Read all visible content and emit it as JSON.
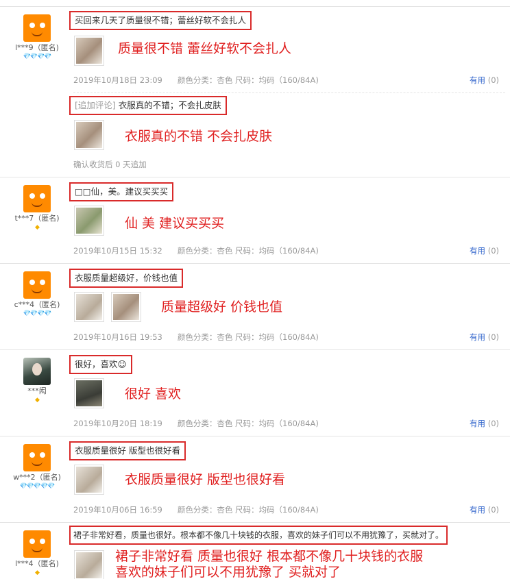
{
  "reviews": [
    {
      "user": "l***9（匿名)",
      "level": "💎💎💎💎",
      "text": "买回来几天了质量很不错；蕾丝好软不会扎人",
      "annotation": "质量很不错   蕾丝好软不会扎人",
      "date": "2019年10月18日 23:09",
      "color": "颜色分类：杏色",
      "size": "尺码：均码（160/84A)",
      "useful_label": "有用",
      "useful_count": "(0)",
      "followup": {
        "tag": "[追加评论]",
        "text": "衣服真的不错；不会扎皮肤",
        "annotation": "衣服真的不错   不会扎皮肤",
        "note": "确认收货后 0 天追加"
      }
    },
    {
      "user": "t***7（匿名)",
      "level": "◆",
      "text": "□□仙，美。建议买买买",
      "annotation": "仙    美    建议买买买",
      "date": "2019年10月15日 15:32",
      "color": "颜色分类：杏色",
      "size": "尺码：均码（160/84A)",
      "useful_label": "有用",
      "useful_count": "(0)"
    },
    {
      "user": "c***4（匿名)",
      "level": "💎💎💎💎",
      "text": "衣服质量超级好，价钱也值",
      "annotation": "质量超级好    价钱也值",
      "date": "2019年10月16日 19:53",
      "color": "颜色分类：杏色",
      "size": "尺码：均码（160/84A)",
      "useful_label": "有用",
      "useful_count": "(0)"
    },
    {
      "user": "***闳",
      "level": "◆",
      "text": "很好，喜欢☺",
      "annotation": "很好   喜欢",
      "date": "2019年10月20日 18:19",
      "color": "颜色分类：杏色",
      "size": "尺码：均码（160/84A)",
      "useful_label": "有用",
      "useful_count": "(0)"
    },
    {
      "user": "w***2（匿名)",
      "level": "💎💎💎💎💎",
      "text": "衣服质量很好 版型也很好看",
      "annotation": "衣服质量很好   版型也很好看",
      "date": "2019年10月06日 16:59",
      "color": "颜色分类：杏色",
      "size": "尺码：均码（160/84A)",
      "useful_label": "有用",
      "useful_count": "(0)"
    },
    {
      "user": "l***4（匿名)",
      "level": "◆",
      "text": "裙子非常好看，质量也很好。根本都不像几十块钱的衣服，喜欢的妹子们可以不用犹豫了，买就对了。",
      "annotation": "裙子非常好看    质量也很好    根本都不像几十块钱的衣服",
      "annotation2": "喜欢的妹子们可以不用犹豫了    买就对了"
    }
  ]
}
